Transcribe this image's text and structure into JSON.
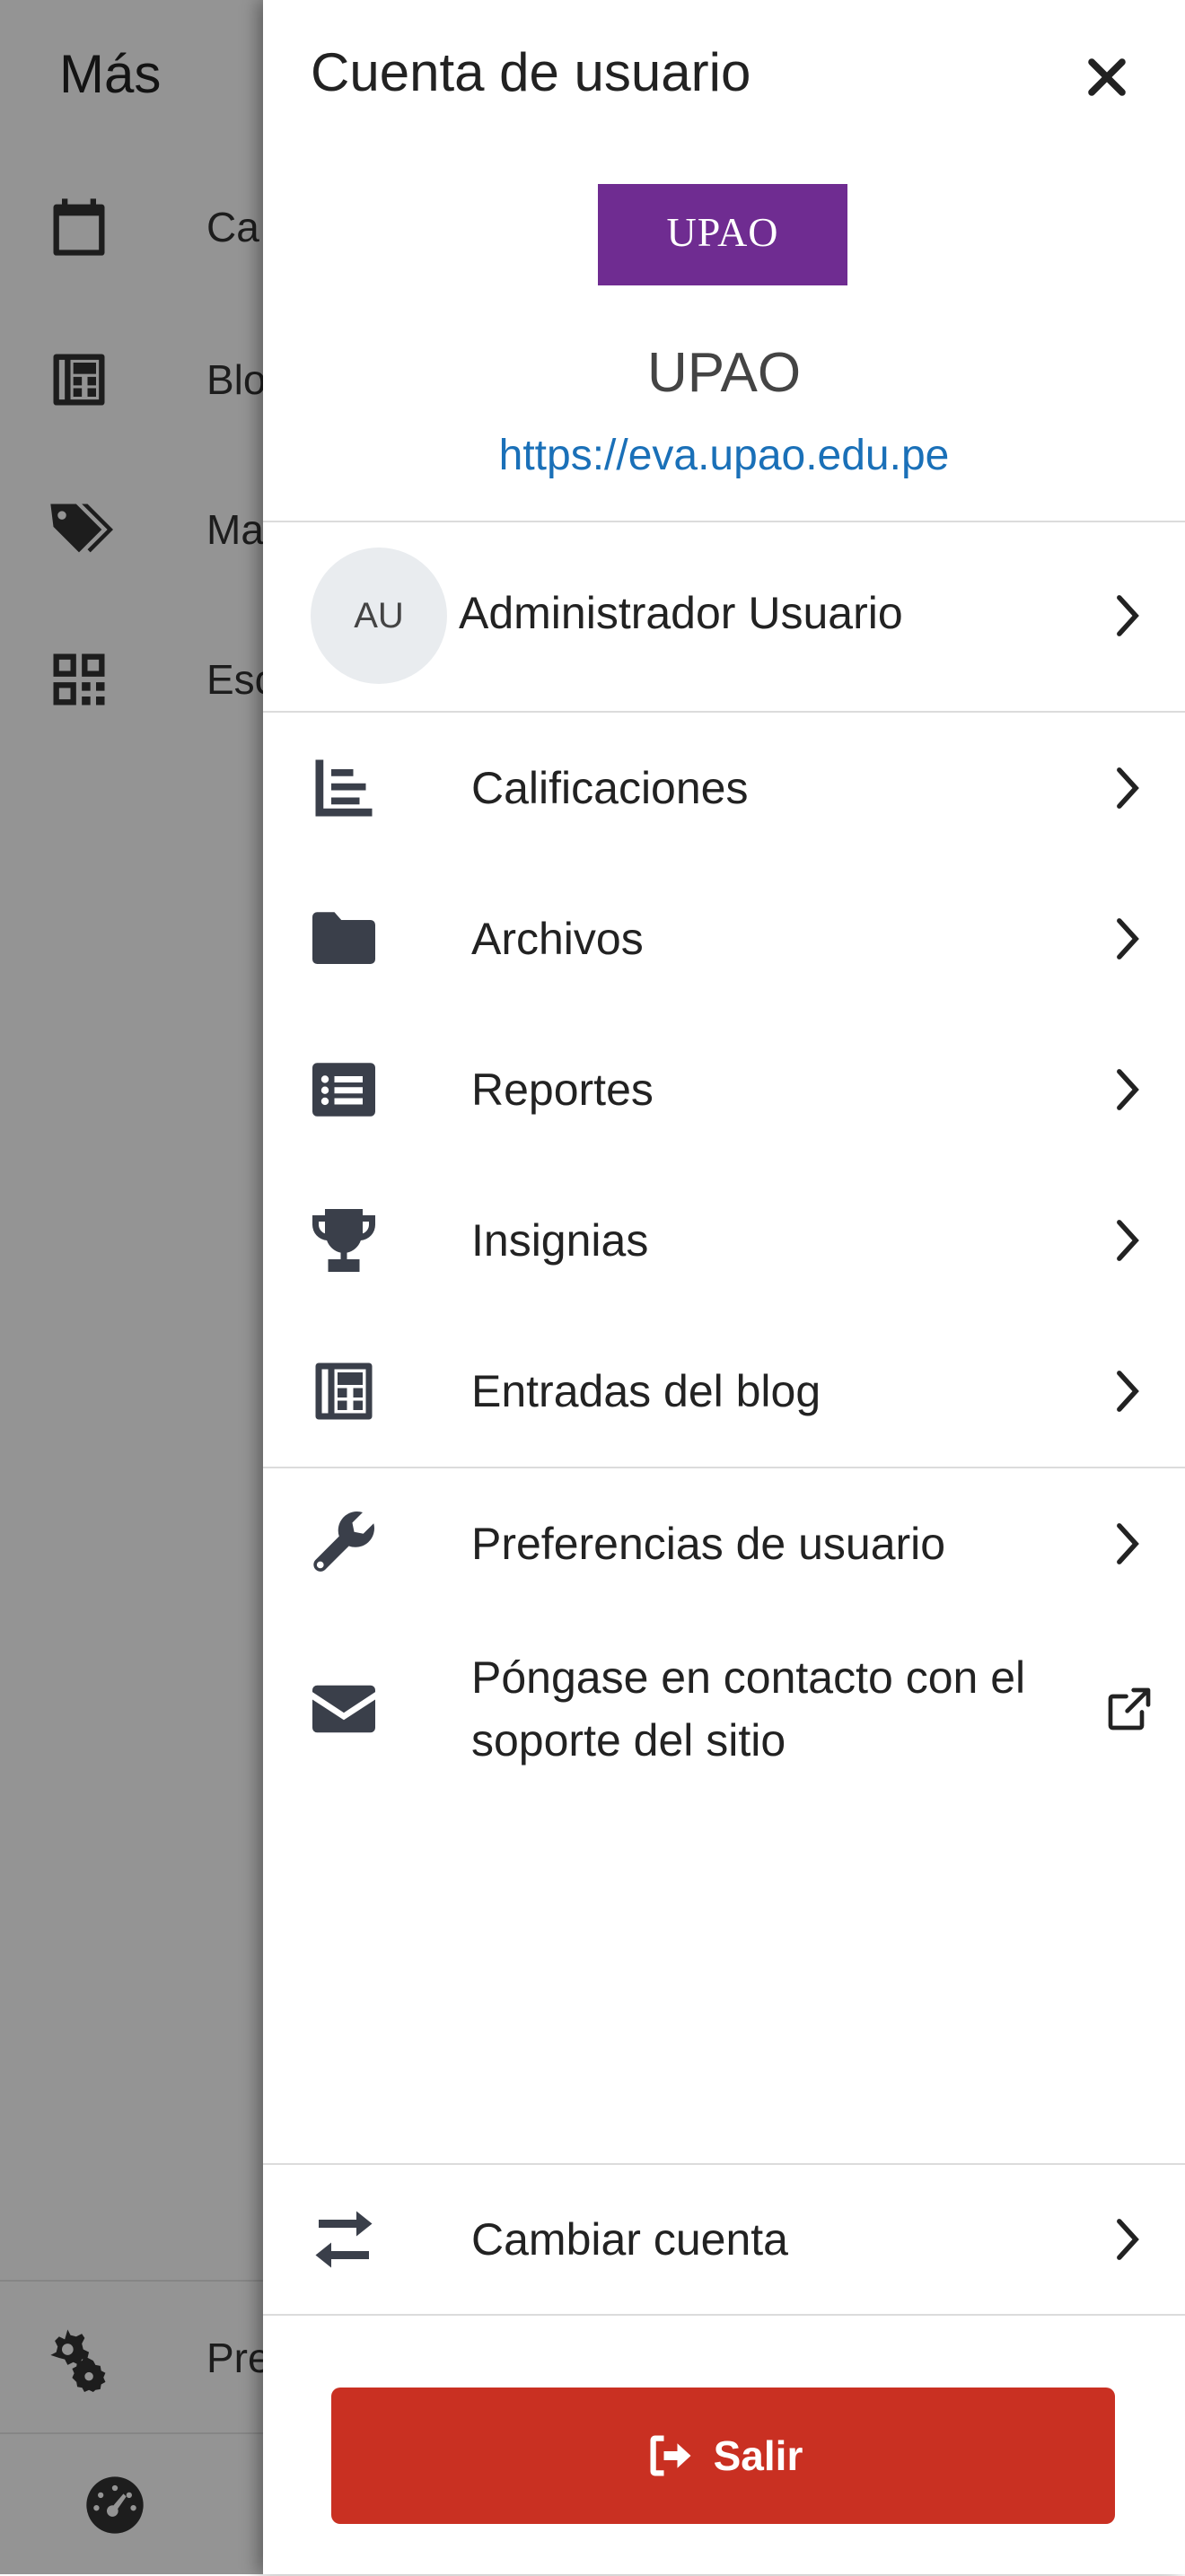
{
  "background": {
    "title": "Más",
    "items": [
      {
        "label": "Ca",
        "icon": "calendar-icon"
      },
      {
        "label": "Blo",
        "icon": "blog-icon"
      },
      {
        "label": "Ma",
        "icon": "tags-icon"
      },
      {
        "label": "Esc",
        "icon": "qrcode-icon"
      }
    ],
    "bottom_items": [
      {
        "label": "Pre",
        "icon": "cogs-icon"
      },
      {
        "label": "",
        "icon": "dashboard-icon"
      }
    ]
  },
  "drawer": {
    "title": "Cuenta de usuario",
    "logo_text": "UPAO",
    "logo_subtext": "",
    "site_name": "UPAO",
    "site_url": "https://eva.upao.edu.pe",
    "user": {
      "initials": "AU",
      "name": "Administrador Usuario"
    },
    "menu": [
      {
        "label": "Calificaciones",
        "icon": "grades-chart-icon"
      },
      {
        "label": "Archivos",
        "icon": "folder-icon"
      },
      {
        "label": "Reportes",
        "icon": "list-alt-icon"
      },
      {
        "label": "Insignias",
        "icon": "trophy-icon"
      },
      {
        "label": "Entradas del blog",
        "icon": "blog-icon"
      }
    ],
    "settings": [
      {
        "label": "Preferencias de usuario",
        "icon": "wrench-icon"
      },
      {
        "label": "Póngase en contacto con el soporte del sitio",
        "icon": "envelope-icon"
      }
    ],
    "switch_account": "Cambiar cuenta",
    "logout": "Salir"
  },
  "colors": {
    "logo_bg": "#6f2c91",
    "link": "#1a70b8",
    "logout_bg": "#c93022"
  }
}
